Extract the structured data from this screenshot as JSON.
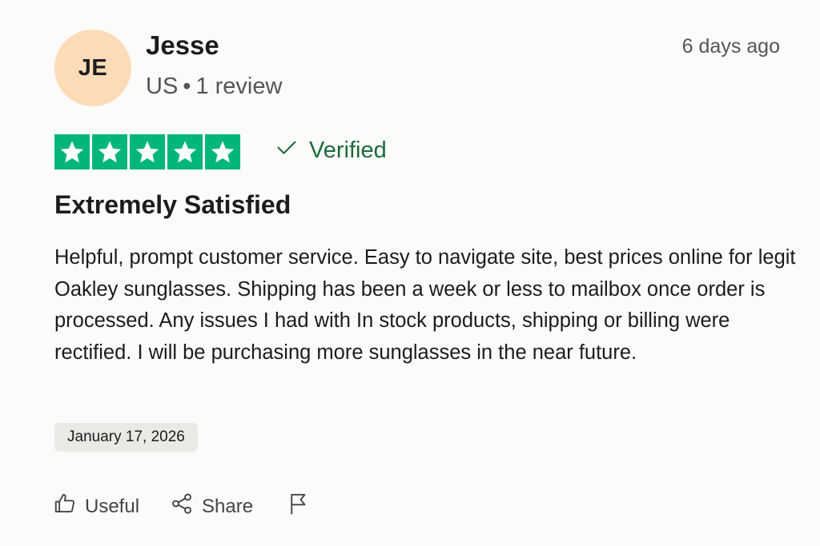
{
  "reviewer": {
    "initials": "JE",
    "name": "Jesse",
    "country": "US",
    "separator": "•",
    "review_count": "1 review",
    "avatar_color": "#fcdcb7"
  },
  "review": {
    "posted_ago": "6 days ago",
    "rating": 5,
    "rating_max": 5,
    "star_color": "#00b67a",
    "verified_label": "Verified",
    "verified_color": "#1e6b3a",
    "title": "Extremely Satisfied",
    "body": "Helpful, prompt customer service. Easy to navigate site, best prices online for legit Oakley sunglasses. Shipping has been a week or less to mailbox once order is processed. Any issues I had with In stock products, shipping or billing were rectified. I will be purchasing more sunglasses in the near future.",
    "experience_date": "January 17, 2026"
  },
  "actions": {
    "useful_label": "Useful",
    "share_label": "Share",
    "useful_icon": "thumbs-up-icon",
    "share_icon": "share-icon",
    "report_icon": "flag-icon"
  }
}
